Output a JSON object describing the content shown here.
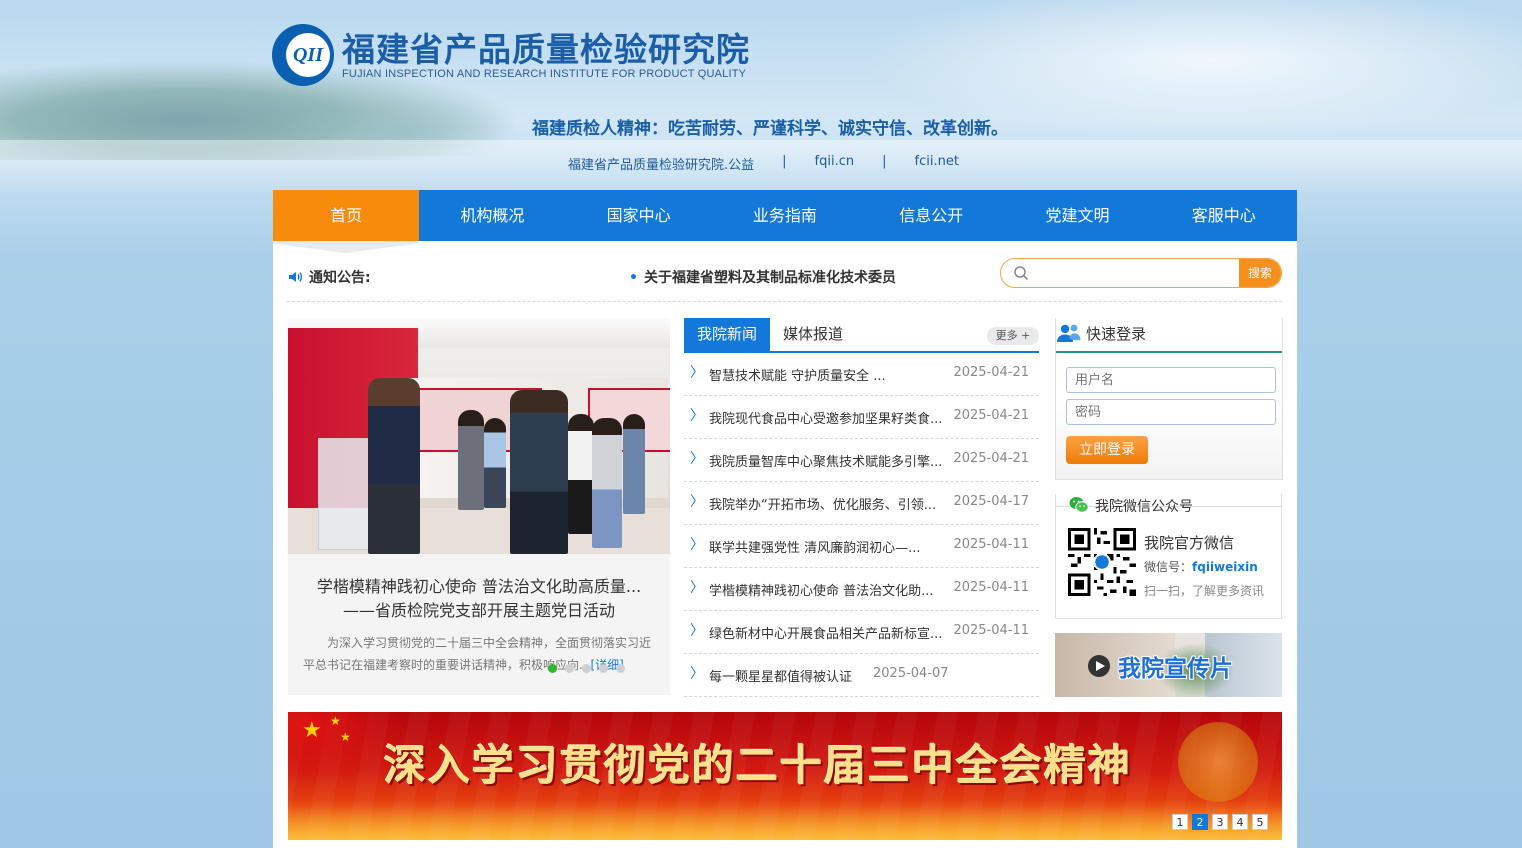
{
  "site": {
    "logo_mark": "QII",
    "name_cn": "福建省产品质量检验研究院",
    "name_en": "FUJIAN INSPECTION AND RESEARCH INSTITUTE FOR PRODUCT QUALITY",
    "slogan": "福建质检人精神：吃苦耐劳、严谨科学、诚实守信、改革创新。",
    "domains": [
      "福建省产品质量检验研究院.公益",
      "fqii.cn",
      "fcii.net"
    ],
    "domain_sep": "|"
  },
  "nav": {
    "items": [
      {
        "label": "首页",
        "active": true
      },
      {
        "label": "机构概况"
      },
      {
        "label": "国家中心"
      },
      {
        "label": "业务指南"
      },
      {
        "label": "信息公开"
      },
      {
        "label": "党建文明"
      },
      {
        "label": "客服中心"
      }
    ]
  },
  "notice": {
    "label": "通知公告:",
    "ticker_bullet": "•",
    "ticker_text": "关于福建省塑料及其制品标准化技术委员"
  },
  "search": {
    "placeholder": "",
    "value": "",
    "button_label": "搜索"
  },
  "featured": {
    "title_line1": "学楷模精神践初心使命 普法治文化助高质量...",
    "title_line2": "——省质检院党支部开展主题党日活动",
    "description": "为深入学习贯彻党的二十届三中全会精神，全面贯彻落实习近平总书记在福建考察时的重要讲话精神，积极响应向...",
    "detail_link": "[详细]",
    "slide_count": 5,
    "active_slide": 1
  },
  "news": {
    "tabs": [
      {
        "label": "我院新闻",
        "active": true
      },
      {
        "label": "媒体报道"
      }
    ],
    "more_label": "更多 +",
    "arrow": "〉",
    "items": [
      {
        "title": "智慧技术赋能 守护质量安全 ...",
        "date": "2025-04-21"
      },
      {
        "title": "我院现代食品中心受邀参加坚果籽类食...",
        "date": "2025-04-21"
      },
      {
        "title": "我院质量智库中心聚焦技术赋能多引擎...",
        "date": "2025-04-21"
      },
      {
        "title": "我院举办“开拓市场、优化服务、引领...",
        "date": "2025-04-17"
      },
      {
        "title": "联学共建强党性 清风廉韵润初心—...",
        "date": "2025-04-11"
      },
      {
        "title": "学楷模精神践初心使命 普法治文化助...",
        "date": "2025-04-11"
      },
      {
        "title": "绿色新材中心开展食品相关产品新标宣...",
        "date": "2025-04-11"
      },
      {
        "title": "每一颗星星都值得被认证",
        "date": "2025-04-07"
      }
    ]
  },
  "login": {
    "title": "快速登录",
    "username_placeholder": "用户名",
    "password_placeholder": "密码",
    "button_label": "立即登录"
  },
  "wechat": {
    "title": "我院微信公众号",
    "account_title": "我院官方微信",
    "id_label": "微信号：",
    "id_value": "fqiiweixin",
    "tip": "扫一扫，了解更多资讯"
  },
  "promo": {
    "label": "我院宣传片"
  },
  "banner": {
    "text": "深入学习贯彻党的二十届三中全会精神",
    "pages": [
      "1",
      "2",
      "3",
      "4",
      "5"
    ],
    "active_page": "2"
  },
  "colors": {
    "primary": "#1279db",
    "accent": "#f98b0c",
    "brand_text": "#1c5da8",
    "banner_red": "#d21a10"
  }
}
